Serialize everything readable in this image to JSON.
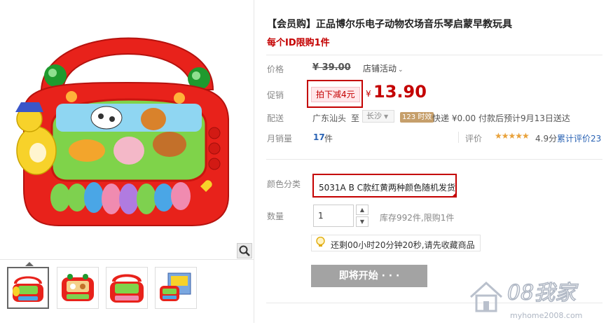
{
  "product": {
    "title": "【会员购】正品博尔乐电子动物农场音乐琴启蒙早教玩具",
    "limit_note": "每个ID限购1件"
  },
  "price_section": {
    "price_label": "价格",
    "original_price": "¥ 39.00",
    "store_activity": "店铺活动",
    "promo_label": "促销",
    "promo_tag": "拍下减4元",
    "currency": "¥",
    "promo_price": "13.90"
  },
  "shipping": {
    "label": "配送",
    "from": "广东汕头",
    "to_label": "至",
    "destination": "长沙",
    "badge": "123 时效",
    "info": "快递 ¥0.00 付款后预计9月13日送达"
  },
  "stats": {
    "sales_label": "月销量",
    "sales_count": "17",
    "sales_unit": "件",
    "review_label": "评价",
    "stars": "★★★★★",
    "rating": "4.9分",
    "review_count": "累计评价23"
  },
  "options": {
    "color_label": "颜色分类",
    "color_value": "5031A B C款红黄两种颜色随机发货",
    "qty_label": "数量",
    "qty_value": "1",
    "stock": "库存992件,限购1件"
  },
  "tip": {
    "text": "还剩00小时20分钟20秒,请先收藏商品"
  },
  "action": {
    "start_label": "即将开始 · · ·"
  },
  "watermark": {
    "brand": "08我家",
    "url": "myhome2008.com"
  },
  "gallery": {
    "thumbnails": [
      "thumbnail-1",
      "thumbnail-2",
      "thumbnail-3",
      "thumbnail-4"
    ]
  },
  "colors": {
    "accent_red": "#c40000",
    "link_blue": "#2a63b4",
    "button_gray": "#a3a3a3",
    "star_gold": "#e9a23b",
    "toy_red": "#e8221b"
  }
}
